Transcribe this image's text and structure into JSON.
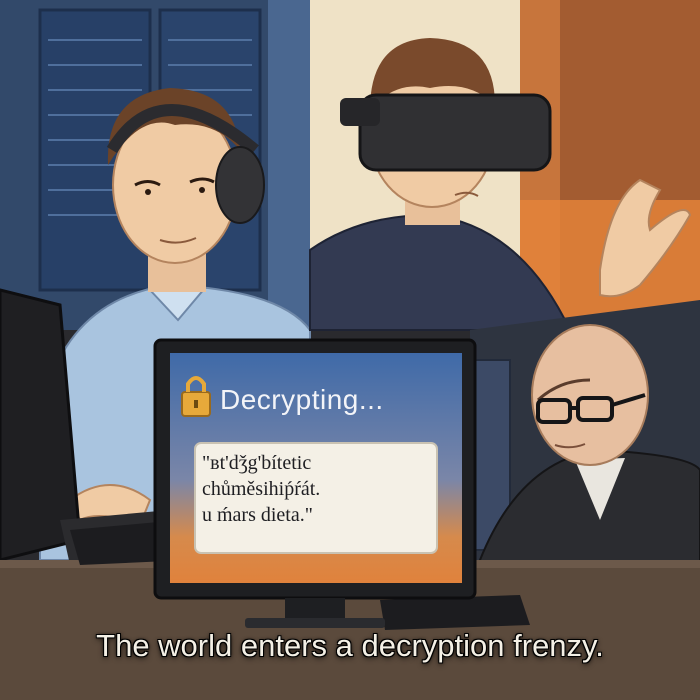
{
  "screen": {
    "status_text": "Decrypting...",
    "lock_icon": "lock-icon",
    "message_lines": [
      "\"ʙt'dǯg'bítetic",
      "chůměsihiṕŕát.",
      "u ḿars dieta.\""
    ]
  },
  "caption": "The world enters a decryption frenzy.",
  "colors": {
    "screen_blue": "#3f6aa8",
    "screen_orange": "#e0823c",
    "lock_gold": "#e7a93a",
    "caption_text": "#f4f0e6"
  }
}
